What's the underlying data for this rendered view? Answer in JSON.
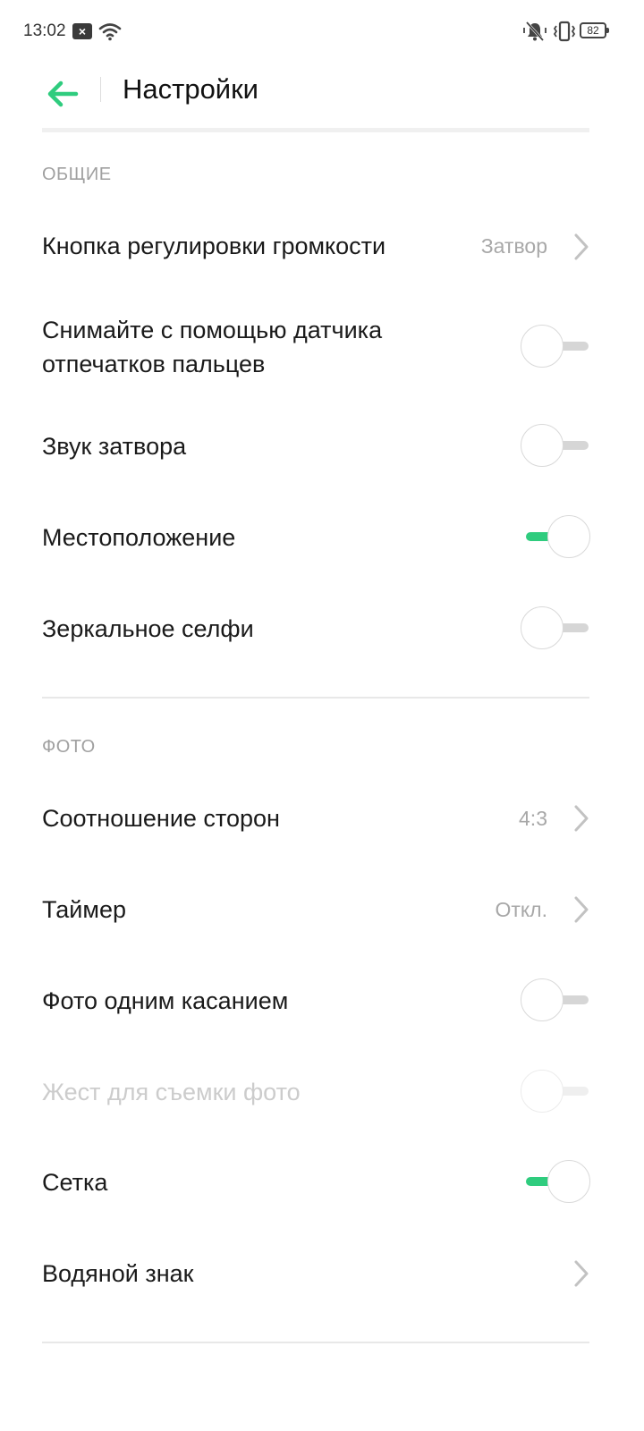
{
  "status_bar": {
    "time": "13:02",
    "battery": "82",
    "icons": [
      "notification-x-icon",
      "wifi-icon",
      "mute-icon",
      "vibrate-icon",
      "battery-icon"
    ]
  },
  "header": {
    "title": "Настройки",
    "back_icon": "back-arrow-icon"
  },
  "colors": {
    "accent": "#2fcc7e",
    "section_title": "#a0a0a0",
    "value_text": "#a8a8a8",
    "disabled_text": "#cccccc"
  },
  "sections": {
    "general": {
      "title": "ОБЩИЕ",
      "volume_button": {
        "label": "Кнопка регулировки громкости",
        "value": "Затвор"
      },
      "fingerprint_shoot": {
        "label_line1": "Снимайте с помощью датчика",
        "label_line2": "отпечатков пальцев",
        "enabled": false
      },
      "shutter_sound": {
        "label": "Звук затвора",
        "enabled": false
      },
      "location": {
        "label": "Местоположение",
        "enabled": true
      },
      "mirror_selfie": {
        "label": "Зеркальное селфи",
        "enabled": false
      }
    },
    "photo": {
      "title": "ФОТО",
      "aspect_ratio": {
        "label": "Соотношение сторон",
        "value": "4:3"
      },
      "timer": {
        "label": "Таймер",
        "value": "Откл."
      },
      "one_touch": {
        "label": "Фото одним касанием",
        "enabled": false
      },
      "gesture": {
        "label": "Жест для съемки фото",
        "enabled": false,
        "disabled": true
      },
      "grid": {
        "label": "Сетка",
        "enabled": true
      },
      "watermark": {
        "label": "Водяной знак"
      }
    }
  }
}
